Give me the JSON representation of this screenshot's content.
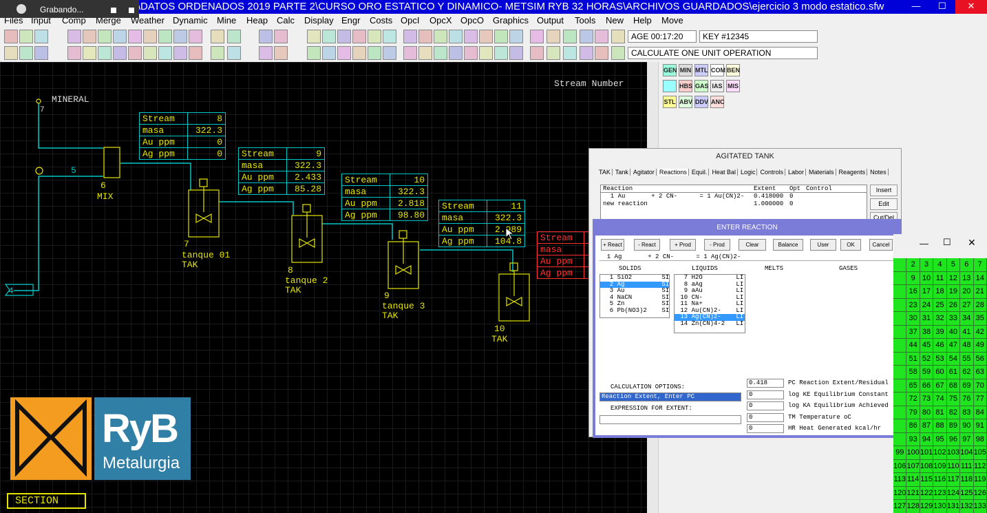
{
  "recorder": {
    "label": "Grabando..."
  },
  "window": {
    "title": "METSIM-2017.09 E:\\DATOS ORDENADOS 2019 PARTE 2\\CURSO ORO ESTATICO  Y DINAMICO- METSIM RYB 32 HORAS\\ARCHIVOS GUARDADOS\\ejercicio 3 modo estatico.sfw"
  },
  "menu": [
    "Files",
    "Input",
    "Comp",
    "Merge",
    "Weather",
    "Dynamic",
    "Mine",
    "Heap",
    "Calc",
    "Display",
    "Engr",
    "Costs",
    "OpcI",
    "OpcX",
    "OpcO",
    "Graphics",
    "Output",
    "Tools",
    "New",
    "Help",
    "Move"
  ],
  "toolbar": {
    "age": "AGE 00:17:20",
    "key": "KEY #12345",
    "status": "CALCULATE ONE UNIT OPERATION"
  },
  "palette": [
    "GEN",
    "MIN",
    "MTL",
    "COM",
    "BEN",
    "",
    "HBS",
    "GAS",
    "IAS",
    "MIS",
    "STL",
    "ABV",
    "DDV",
    "ANC"
  ],
  "flowsheet": {
    "stream_number_label": "Stream Number",
    "mineral_label": "MINERAL",
    "stream7": "7",
    "stream5": "5",
    "stream4": "4",
    "mix": {
      "num": "6",
      "name": "MIX"
    },
    "tank1": {
      "num": "7",
      "name": "tanque 01",
      "type": "TAK"
    },
    "tank2": {
      "num": "8",
      "name": "tanque 2",
      "type": "TAK"
    },
    "tank3": {
      "num": "9",
      "name": "tanque 3",
      "type": "TAK"
    },
    "tank4": {
      "num": "10",
      "type": "TAK"
    },
    "section": "SECTION"
  },
  "streams": [
    {
      "id": "8",
      "rows": [
        [
          "Stream",
          "8"
        ],
        [
          "masa",
          "322.3"
        ],
        [
          "Au ppm",
          "0"
        ],
        [
          "Ag ppm",
          "0"
        ]
      ]
    },
    {
      "id": "9",
      "rows": [
        [
          "Stream",
          "9"
        ],
        [
          "masa",
          "322.3"
        ],
        [
          "Au ppm",
          "2.433"
        ],
        [
          "Ag ppm",
          "85.28"
        ]
      ]
    },
    {
      "id": "10",
      "rows": [
        [
          "Stream",
          "10"
        ],
        [
          "masa",
          "322.3"
        ],
        [
          "Au ppm",
          "2.818"
        ],
        [
          "Ag ppm",
          "98.80"
        ]
      ]
    },
    {
      "id": "11",
      "rows": [
        [
          "Stream",
          "11"
        ],
        [
          "masa",
          "322.3"
        ],
        [
          "Au ppm",
          "2.989"
        ],
        [
          "Ag ppm",
          "104.8"
        ]
      ]
    },
    {
      "id": "red",
      "rows": [
        [
          "Stream",
          ""
        ],
        [
          "masa",
          ""
        ],
        [
          "Au ppm",
          ""
        ],
        [
          "Ag ppm",
          ""
        ]
      ]
    }
  ],
  "logo": {
    "brand": "RyB",
    "sub": "Metalurgia"
  },
  "agitated": {
    "title": "AGITATED TANK",
    "tabs": [
      "TAK",
      "Tank",
      "Agitator",
      "Reactions",
      "Equil.",
      "Heat Bal",
      "Logic",
      "Controls",
      "Labor",
      "Materials",
      "Reagents",
      "Notes"
    ],
    "list_header": {
      "reaction": "Reaction",
      "extent": "Extent",
      "opt": "Opt",
      "control": "Control"
    },
    "rows": [
      {
        "reaction": "  1 Au       + 2 CN-      = 1 Au(CN)2-",
        "extent": "0.418000",
        "opt": "0"
      },
      {
        "reaction": "new reaction",
        "extent": "1.000000",
        "opt": "0"
      }
    ],
    "buttons": [
      "Insert",
      "Edit",
      "Cut/Del"
    ]
  },
  "enter": {
    "title": "ENTER REACTION",
    "buttons": [
      "+ React",
      "- React",
      "+ Prod",
      "- Prod",
      "Clear",
      "Balance",
      "User",
      "OK",
      "Cancel"
    ],
    "equation": "  1 Ag       + 2 CN-      = 1 Ag(CN)2-",
    "cols": [
      "SOLIDS",
      "LIQUIDS",
      "MELTS",
      "GASES"
    ],
    "solids": [
      "  1 SiO2        SI",
      "  2 Ag          SI",
      "  3 Au          SI",
      "  4 NaCN        SI",
      "  5 Zn          SI",
      "  6 Pb(NO3)2    SI"
    ],
    "liquids": [
      "  7 H2O         LI",
      "  8 aAg         LI",
      "  9 aAu         LI",
      " 10 CN-         LI",
      " 11 Na+         LI",
      " 12 Au(CN)2-    LI",
      " 13 Ag(CN)2-    LI",
      " 14 Zn(CN)4-2   LI"
    ],
    "calc_label": "CALCULATION OPTIONS:",
    "calc_value": "Reaction Extent, Enter PC",
    "expr_label": "EXPRESSION FOR EXTENT:",
    "params": [
      {
        "value": "0.418",
        "label": "PC Reaction Extent/Residual"
      },
      {
        "value": "0",
        "label": "log KE Equilibrium Constant"
      },
      {
        "value": "0",
        "label": "log KA Equilibrium Achieved"
      },
      {
        "value": "0",
        "label": "TM Temperature oC"
      },
      {
        "value": "0",
        "label": "HR Heat Generated kcal/hr"
      }
    ]
  },
  "numgrid": [
    [
      "",
      "2",
      "3",
      "4",
      "5",
      "6",
      "7"
    ],
    [
      "",
      "9",
      "10",
      "11",
      "12",
      "13",
      "14"
    ],
    [
      "",
      "16",
      "17",
      "18",
      "19",
      "20",
      "21"
    ],
    [
      "",
      "23",
      "24",
      "25",
      "26",
      "27",
      "28"
    ],
    [
      "",
      "30",
      "31",
      "32",
      "33",
      "34",
      "35"
    ],
    [
      "",
      "37",
      "38",
      "39",
      "40",
      "41",
      "42"
    ],
    [
      "",
      "44",
      "45",
      "46",
      "47",
      "48",
      "49"
    ],
    [
      "",
      "51",
      "52",
      "53",
      "54",
      "55",
      "56"
    ],
    [
      "",
      "58",
      "59",
      "60",
      "61",
      "62",
      "63"
    ],
    [
      "",
      "65",
      "66",
      "67",
      "68",
      "69",
      "70"
    ],
    [
      "",
      "72",
      "73",
      "74",
      "75",
      "76",
      "77"
    ],
    [
      "",
      "79",
      "80",
      "81",
      "82",
      "83",
      "84"
    ],
    [
      "",
      "86",
      "87",
      "88",
      "89",
      "90",
      "91"
    ],
    [
      "",
      "93",
      "94",
      "95",
      "96",
      "97",
      "98"
    ],
    [
      "99",
      "100",
      "101",
      "102",
      "103",
      "104",
      "105"
    ],
    [
      "106",
      "107",
      "108",
      "109",
      "110",
      "111",
      "112"
    ],
    [
      "113",
      "114",
      "115",
      "116",
      "117",
      "118",
      "119"
    ],
    [
      "120",
      "121",
      "122",
      "123",
      "124",
      "125",
      "126"
    ],
    [
      "127",
      "128",
      "129",
      "130",
      "131",
      "132",
      "133"
    ]
  ]
}
